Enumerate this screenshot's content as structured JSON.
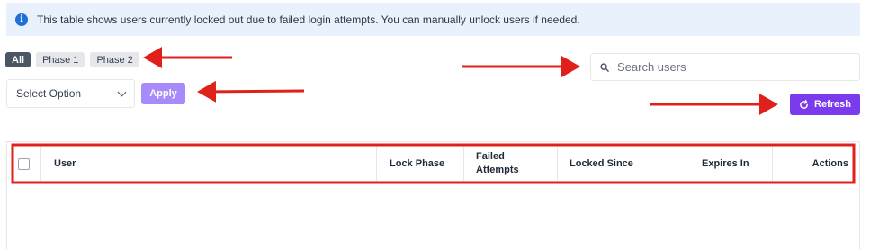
{
  "notice": {
    "icon": "info-icon",
    "text": "This table shows users currently locked out due to failed login attempts. You can manually unlock users if needed."
  },
  "filters": {
    "pills": [
      {
        "label": "All",
        "active": true
      },
      {
        "label": "Phase 1",
        "active": false
      },
      {
        "label": "Phase 2",
        "active": false
      }
    ]
  },
  "bulk_action": {
    "select_value": "Select Option",
    "apply_label": "Apply"
  },
  "search": {
    "placeholder": "Search users"
  },
  "refresh": {
    "label": "Refresh",
    "icon": "refresh-icon"
  },
  "table": {
    "columns": [
      "User",
      "Lock Phase",
      "Failed Attempts",
      "Locked Since",
      "Expires In",
      "Actions"
    ],
    "rows": []
  },
  "colors": {
    "accent": "#7c3aed",
    "apply": "#a78bfa",
    "notice_bg": "#e8f1fc",
    "annotation": "#e0201a"
  }
}
